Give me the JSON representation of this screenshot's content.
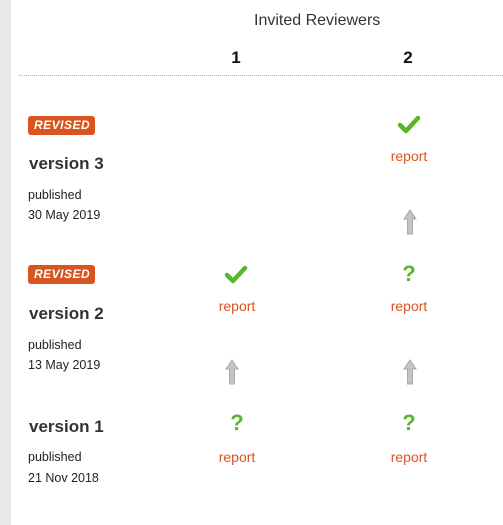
{
  "header": {
    "title": "Invited Reviewers",
    "columns": [
      "1",
      "2"
    ]
  },
  "versions": [
    {
      "badge": "REVISED",
      "title": "version 3",
      "published_label": "published",
      "date": "30 May 2019",
      "reviews": [
        {
          "reviewer": "1",
          "status": "none"
        },
        {
          "reviewer": "2",
          "status": "approved",
          "icon": "check-icon",
          "link": "report"
        }
      ]
    },
    {
      "badge": "REVISED",
      "title": "version 2",
      "published_label": "published",
      "date": "13 May 2019",
      "reviews": [
        {
          "reviewer": "1",
          "status": "approved",
          "icon": "check-icon",
          "link": "report"
        },
        {
          "reviewer": "2",
          "status": "reservations",
          "icon": "question-icon",
          "link": "report"
        }
      ]
    },
    {
      "title": "version 1",
      "published_label": "published",
      "date": "21 Nov 2018",
      "reviews": [
        {
          "reviewer": "1",
          "status": "reservations",
          "icon": "question-icon",
          "link": "report"
        },
        {
          "reviewer": "2",
          "status": "reservations",
          "icon": "question-icon",
          "link": "report"
        }
      ]
    }
  ],
  "colors": {
    "accent": "#d9541e",
    "approved": "#58b728",
    "arrow": "#bdbdbd"
  },
  "icons": {
    "check": "✔",
    "question": "?"
  }
}
